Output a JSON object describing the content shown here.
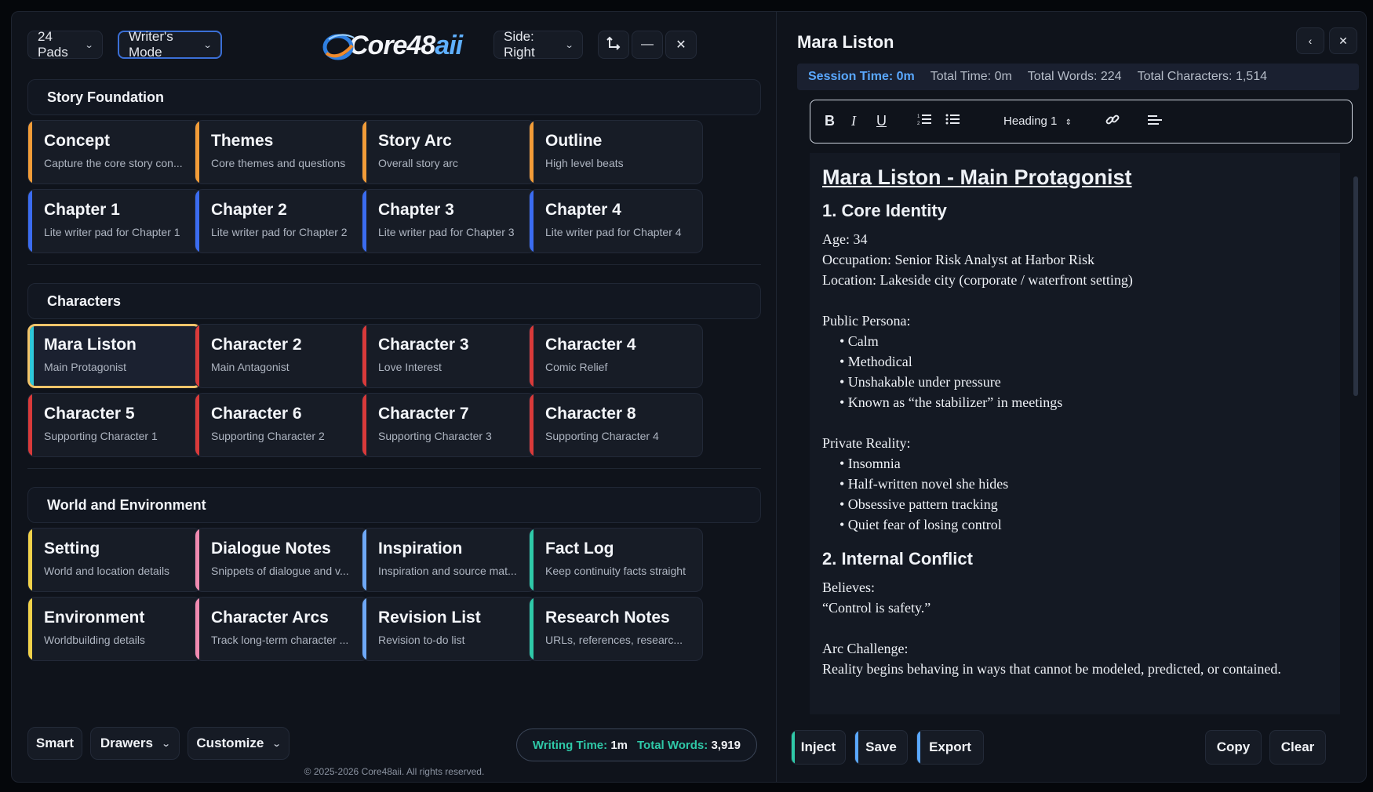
{
  "header": {
    "pads_label": "24 Pads",
    "mode_label": "Writer's Mode",
    "logo_text_a": "Core48",
    "logo_text_b": "aii",
    "side_label": "Side: Right"
  },
  "sections": [
    {
      "title": "Story Foundation",
      "cards": [
        {
          "title": "Concept",
          "sub": "Capture the core story con...",
          "accent": "#f29c38"
        },
        {
          "title": "Themes",
          "sub": "Core themes and questions",
          "accent": "#f29c38"
        },
        {
          "title": "Story Arc",
          "sub": "Overall story arc",
          "accent": "#f29c38"
        },
        {
          "title": "Outline",
          "sub": "High level beats",
          "accent": "#f29c38"
        },
        {
          "title": "Chapter 1",
          "sub": "Lite writer pad for Chapter 1",
          "accent": "#3b6cf0"
        },
        {
          "title": "Chapter 2",
          "sub": "Lite writer pad for Chapter 2",
          "accent": "#3b6cf0"
        },
        {
          "title": "Chapter 3",
          "sub": "Lite writer pad for Chapter 3",
          "accent": "#3b6cf0"
        },
        {
          "title": "Chapter 4",
          "sub": "Lite writer pad for Chapter 4",
          "accent": "#3b6cf0"
        }
      ]
    },
    {
      "title": "Characters",
      "cards": [
        {
          "title": "Mara Liston",
          "sub": "Main Protagonist",
          "accent": "#2fc9d9",
          "active": true
        },
        {
          "title": "Character 2",
          "sub": "Main Antagonist",
          "accent": "#d93a3a"
        },
        {
          "title": "Character 3",
          "sub": "Love Interest",
          "accent": "#d93a3a"
        },
        {
          "title": "Character 4",
          "sub": "Comic Relief",
          "accent": "#d93a3a"
        },
        {
          "title": "Character 5",
          "sub": "Supporting Character 1",
          "accent": "#d93a3a"
        },
        {
          "title": "Character 6",
          "sub": "Supporting Character 2",
          "accent": "#d93a3a"
        },
        {
          "title": "Character 7",
          "sub": "Supporting Character 3",
          "accent": "#d93a3a"
        },
        {
          "title": "Character 8",
          "sub": "Supporting Character 4",
          "accent": "#d93a3a"
        }
      ]
    },
    {
      "title": "World and Environment",
      "cards": [
        {
          "title": "Setting",
          "sub": "World and location details",
          "accent": "#f2d24a"
        },
        {
          "title": "Dialogue Notes",
          "sub": "Snippets of dialogue and v...",
          "accent": "#f08ab0"
        },
        {
          "title": "Inspiration",
          "sub": "Inspiration and source mat...",
          "accent": "#6ea8f5"
        },
        {
          "title": "Fact Log",
          "sub": "Keep continuity facts straight",
          "accent": "#2fc9a8"
        },
        {
          "title": "Environment",
          "sub": "Worldbuilding details",
          "accent": "#f2d24a"
        },
        {
          "title": "Character Arcs",
          "sub": "Track long-term character ...",
          "accent": "#f08ab0"
        },
        {
          "title": "Revision List",
          "sub": "Revision to-do list",
          "accent": "#6ea8f5"
        },
        {
          "title": "Research Notes",
          "sub": "URLs, references, researc...",
          "accent": "#2fc9a8"
        }
      ]
    }
  ],
  "bottom": {
    "smart": "Smart",
    "drawers": "Drawers",
    "customize": "Customize",
    "writing_time_label": "Writing Time:",
    "writing_time_value": "1m",
    "total_words_label": "Total Words:",
    "total_words_value": "3,919"
  },
  "copyright": "© 2025-2026 Core48aii. All rights reserved.",
  "editor_panel": {
    "title": "Mara Liston",
    "session_time": "Session Time: 0m",
    "total_time": "Total Time: 0m",
    "total_words": "Total Words: 224",
    "total_chars": "Total Characters: 1,514",
    "heading_select": "Heading 1",
    "doc": {
      "h1": "Mara Liston - Main Protagonist",
      "s1": "1. Core Identity",
      "age": "Age: 34",
      "occupation": "Occupation: Senior Risk Analyst at Harbor Risk",
      "location": "Location: Lakeside city (corporate / waterfront setting)",
      "public": "Public Persona:",
      "public_items": [
        "• Calm",
        "• Methodical",
        "• Unshakable under pressure",
        "• Known as “the stabilizer” in meetings"
      ],
      "private": "Private Reality:",
      "private_items": [
        "• Insomnia",
        "• Half-written novel she hides",
        "• Obsessive pattern tracking",
        "• Quiet fear of losing control"
      ],
      "s2": "2. Internal Conflict",
      "believes": "Believes:",
      "belief_quote": "“Control is safety.”",
      "arc": "Arc Challenge:",
      "arc_text": "Reality begins behaving in ways that cannot be modeled, predicted, or contained."
    },
    "actions": {
      "inject": "Inject",
      "save": "Save",
      "export": "Export",
      "copy": "Copy",
      "clear": "Clear"
    }
  }
}
